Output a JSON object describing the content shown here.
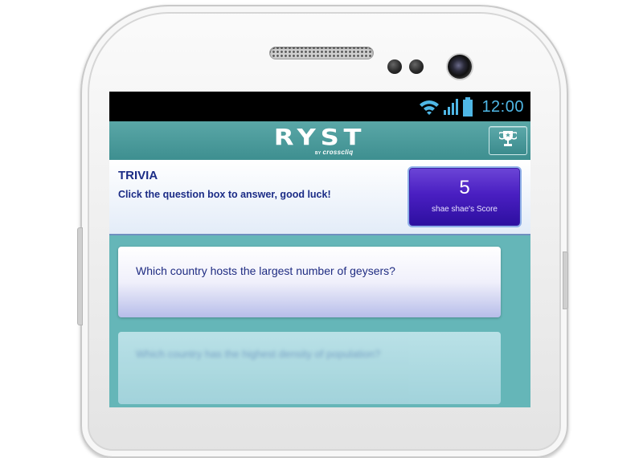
{
  "status_bar": {
    "time": "12:00",
    "icons": [
      "wifi-icon",
      "signal-icon",
      "battery-icon"
    ]
  },
  "app_bar": {
    "logo": "RYST",
    "logo_by": "BY",
    "logo_brand": "crosscliq",
    "trophy_icon": "trophy-icon"
  },
  "trivia": {
    "title": "TRIVIA",
    "instructions": "Click the question box to answer, good luck!",
    "score": {
      "value": "5",
      "label": "shae shae's Score"
    }
  },
  "questions": [
    {
      "text": "Which country hosts the largest number of geysers?"
    },
    {
      "text": "Which country has the highest density of population?"
    }
  ],
  "colors": {
    "status_accent": "#4fb7e6",
    "app_bar": "#4a9c9d",
    "text_primary": "#1b2c86",
    "score_box": "#4a1fc2",
    "screen_background": "#65b6b8"
  }
}
